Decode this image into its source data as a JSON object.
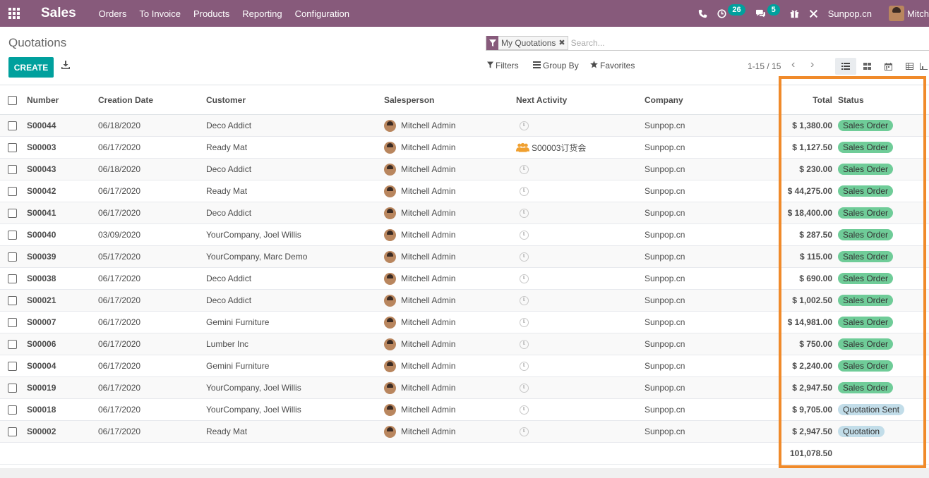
{
  "navbar": {
    "app_name": "Sales",
    "menu": [
      "Orders",
      "To Invoice",
      "Products",
      "Reporting",
      "Configuration"
    ],
    "activity_count": "26",
    "message_count": "5",
    "company": "Sunpop.cn",
    "user": "Mitch"
  },
  "control_panel": {
    "title": "Quotations",
    "facet_label": "My Quotations",
    "search_placeholder": "Search...",
    "create_label": "CREATE",
    "filters_label": "Filters",
    "group_by_label": "Group By",
    "favorites_label": "Favorites",
    "pager_value": "1-15 / 15"
  },
  "table": {
    "headers": {
      "number": "Number",
      "creation_date": "Creation Date",
      "customer": "Customer",
      "salesperson": "Salesperson",
      "next_activity": "Next Activity",
      "company": "Company",
      "total": "Total",
      "status": "Status"
    },
    "rows": [
      {
        "number": "S00044",
        "date": "06/18/2020",
        "customer": "Deco Addict",
        "salesperson": "Mitchell Admin",
        "activity": "",
        "company": "Sunpop.cn",
        "total": "$ 1,380.00",
        "status": "Sales Order"
      },
      {
        "number": "S00003",
        "date": "06/17/2020",
        "customer": "Ready Mat",
        "salesperson": "Mitchell Admin",
        "activity": "S00003订货会",
        "company": "Sunpop.cn",
        "total": "$ 1,127.50",
        "status": "Sales Order"
      },
      {
        "number": "S00043",
        "date": "06/18/2020",
        "customer": "Deco Addict",
        "salesperson": "Mitchell Admin",
        "activity": "",
        "company": "Sunpop.cn",
        "total": "$ 230.00",
        "status": "Sales Order"
      },
      {
        "number": "S00042",
        "date": "06/17/2020",
        "customer": "Ready Mat",
        "salesperson": "Mitchell Admin",
        "activity": "",
        "company": "Sunpop.cn",
        "total": "$ 44,275.00",
        "status": "Sales Order"
      },
      {
        "number": "S00041",
        "date": "06/17/2020",
        "customer": "Deco Addict",
        "salesperson": "Mitchell Admin",
        "activity": "",
        "company": "Sunpop.cn",
        "total": "$ 18,400.00",
        "status": "Sales Order"
      },
      {
        "number": "S00040",
        "date": "03/09/2020",
        "customer": "YourCompany, Joel Willis",
        "salesperson": "Mitchell Admin",
        "activity": "",
        "company": "Sunpop.cn",
        "total": "$ 287.50",
        "status": "Sales Order"
      },
      {
        "number": "S00039",
        "date": "05/17/2020",
        "customer": "YourCompany, Marc Demo",
        "salesperson": "Mitchell Admin",
        "activity": "",
        "company": "Sunpop.cn",
        "total": "$ 115.00",
        "status": "Sales Order"
      },
      {
        "number": "S00038",
        "date": "06/17/2020",
        "customer": "Deco Addict",
        "salesperson": "Mitchell Admin",
        "activity": "",
        "company": "Sunpop.cn",
        "total": "$ 690.00",
        "status": "Sales Order"
      },
      {
        "number": "S00021",
        "date": "06/17/2020",
        "customer": "Deco Addict",
        "salesperson": "Mitchell Admin",
        "activity": "",
        "company": "Sunpop.cn",
        "total": "$ 1,002.50",
        "status": "Sales Order"
      },
      {
        "number": "S00007",
        "date": "06/17/2020",
        "customer": "Gemini Furniture",
        "salesperson": "Mitchell Admin",
        "activity": "",
        "company": "Sunpop.cn",
        "total": "$ 14,981.00",
        "status": "Sales Order"
      },
      {
        "number": "S00006",
        "date": "06/17/2020",
        "customer": "Lumber Inc",
        "salesperson": "Mitchell Admin",
        "activity": "",
        "company": "Sunpop.cn",
        "total": "$ 750.00",
        "status": "Sales Order"
      },
      {
        "number": "S00004",
        "date": "06/17/2020",
        "customer": "Gemini Furniture",
        "salesperson": "Mitchell Admin",
        "activity": "",
        "company": "Sunpop.cn",
        "total": "$ 2,240.00",
        "status": "Sales Order"
      },
      {
        "number": "S00019",
        "date": "06/17/2020",
        "customer": "YourCompany, Joel Willis",
        "salesperson": "Mitchell Admin",
        "activity": "",
        "company": "Sunpop.cn",
        "total": "$ 2,947.50",
        "status": "Sales Order"
      },
      {
        "number": "S00018",
        "date": "06/17/2020",
        "customer": "YourCompany, Joel Willis",
        "salesperson": "Mitchell Admin",
        "activity": "",
        "company": "Sunpop.cn",
        "total": "$ 9,705.00",
        "status": "Quotation Sent"
      },
      {
        "number": "S00002",
        "date": "06/17/2020",
        "customer": "Ready Mat",
        "salesperson": "Mitchell Admin",
        "activity": "",
        "company": "Sunpop.cn",
        "total": "$ 2,947.50",
        "status": "Quotation"
      }
    ],
    "grand_total": "101,078.50"
  },
  "colors": {
    "navbar": "#875a7b",
    "primary": "#00a09d",
    "sales_order_badge": "#6fcc98",
    "quotation_badge": "#c2dde9",
    "highlight": "#f08a2a"
  }
}
